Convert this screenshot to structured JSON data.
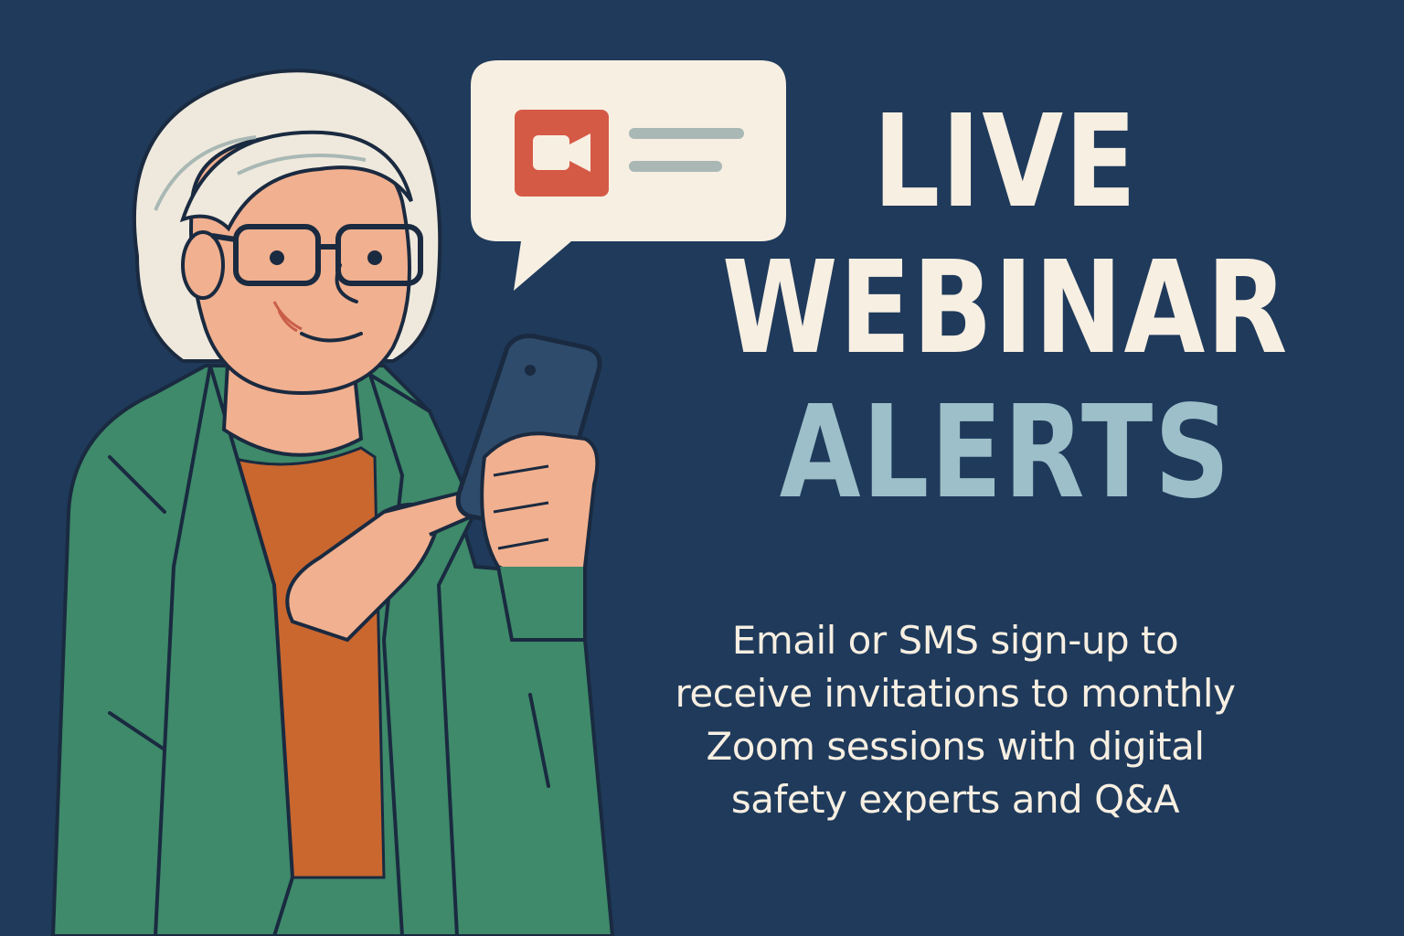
{
  "headline": {
    "line1": "LIVE",
    "line2": "WEBINAR",
    "line3": "ALERTS"
  },
  "subtitle": {
    "lines": [
      "Email or SMS sign-up to",
      "receive invitations to monthly",
      "Zoom sessions with digital",
      "safety experts and Q&A"
    ]
  },
  "colors": {
    "background": "#1f3a5b",
    "headline_light": "#f7efe2",
    "headline_accent": "#9cbfc9",
    "jacket": "#3e8a6a",
    "shirt": "#c9672f",
    "skin": "#f1b08f",
    "hair": "#efe9dd",
    "video_icon": "#d55a46",
    "bubble": "#f7efe2"
  },
  "icons": {
    "speech_bubble": "speech-bubble-icon",
    "video_camera": "video-camera-icon",
    "smartphone": "smartphone-icon"
  }
}
